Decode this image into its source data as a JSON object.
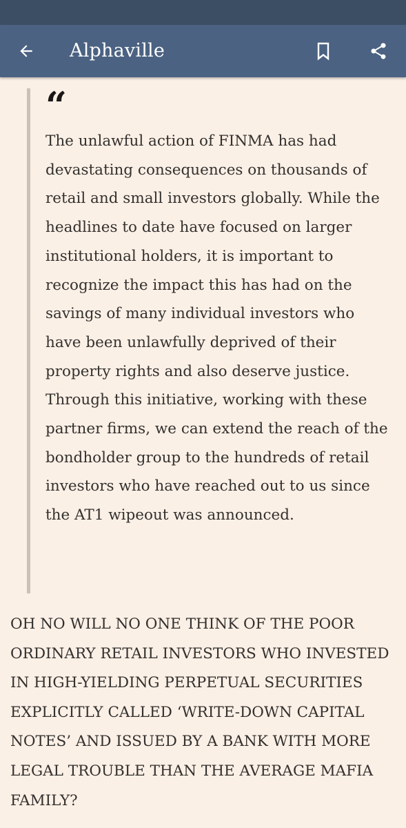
{
  "app_bar": {
    "title": "Alphaville",
    "back_icon": "arrow-left-icon",
    "bookmark_icon": "bookmark-icon",
    "share_icon": "share-icon"
  },
  "colors": {
    "status_bar": "#3b4e64",
    "app_bar": "#4b6282",
    "background": "#fbf0e6",
    "text": "#33302e",
    "quote_rule": "#ccc1b7"
  },
  "article": {
    "quote_mark": "“",
    "quote_text": "The unlawful action of FINMA has had devastating consequences on thousands of retail and small investors globally. While the headlines to date have focused on larger institutional holders, it is important to recognize the impact this has had on the savings of many individual investors who have been unlawfully deprived of their property rights and also deserve justice. Through this initiative, working with these partner firms, we can extend the reach of the bondholder group to the hundreds of retail investors who have reached out to us since the AT1 wipeout was announced.",
    "paragraph": "OH NO WILL NO ONE THINK OF THE POOR ORDINARY RETAIL INVESTORS WHO INVESTED IN HIGH-YIELDING PERPETUAL SECURITIES EXPLICITLY CALLED ‘WRITE-DOWN CAPITAL NOTES’ AND ISSUED BY A BANK WITH MORE LEGAL TROUBLE THAN THE AVERAGE MAFIA FAMILY?"
  }
}
